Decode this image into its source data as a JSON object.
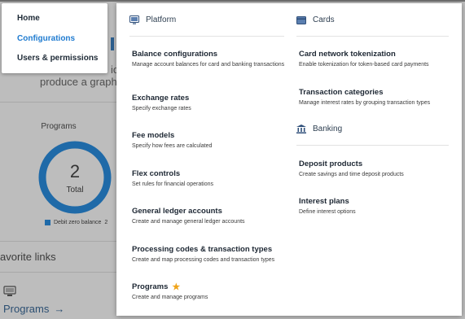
{
  "background": {
    "produce_tail": "produce a graph",
    "o_fragment": "io",
    "programs_card": {
      "title": "Programs",
      "donut_value": "2",
      "donut_label": "Total",
      "legend_label": "Debit zero balance",
      "legend_count": "2",
      "legend_color": "#1f6aa8"
    },
    "favorite_links_title": "avorite links",
    "favorite_link_label": "Programs",
    "favorite_link_arrow": "→"
  },
  "nav": {
    "items": [
      {
        "label": "Home",
        "active": false
      },
      {
        "label": "Configurations",
        "active": true
      },
      {
        "label": "Users & permissions",
        "active": false
      }
    ],
    "active_color": "#1f7bd0"
  },
  "menu": {
    "platform": {
      "title": "Platform",
      "icon": "platform-icon",
      "items": [
        {
          "label": "Balance configurations",
          "desc": "Manage account balances for card and banking transactions",
          "starred": false
        },
        {
          "label": "Exchange rates",
          "desc": "Specify exchange rates",
          "starred": false
        },
        {
          "label": "Fee models",
          "desc": "Specify how fees are calculated",
          "starred": false
        },
        {
          "label": "Flex controls",
          "desc": "Set rules for financial operations",
          "starred": false
        },
        {
          "label": "General ledger accounts",
          "desc": "Create and manage general ledger accounts",
          "starred": false
        },
        {
          "label": "Processing codes & transaction types",
          "desc": "Create and map processing codes and transaction types",
          "starred": false
        },
        {
          "label": "Programs",
          "desc": "Create and manage programs",
          "starred": true
        }
      ]
    },
    "cards": {
      "title": "Cards",
      "icon": "card-icon",
      "items": [
        {
          "label": "Card network tokenization",
          "desc": "Enable tokenization for token-based card payments"
        },
        {
          "label": "Transaction categories",
          "desc": "Manage interest rates by grouping transaction types"
        }
      ]
    },
    "banking": {
      "title": "Banking",
      "icon": "bank-icon",
      "items": [
        {
          "label": "Deposit products",
          "desc": "Create savings and time deposit products"
        },
        {
          "label": "Interest plans",
          "desc": "Define interest options"
        }
      ]
    },
    "star_color": "#f0a419"
  }
}
